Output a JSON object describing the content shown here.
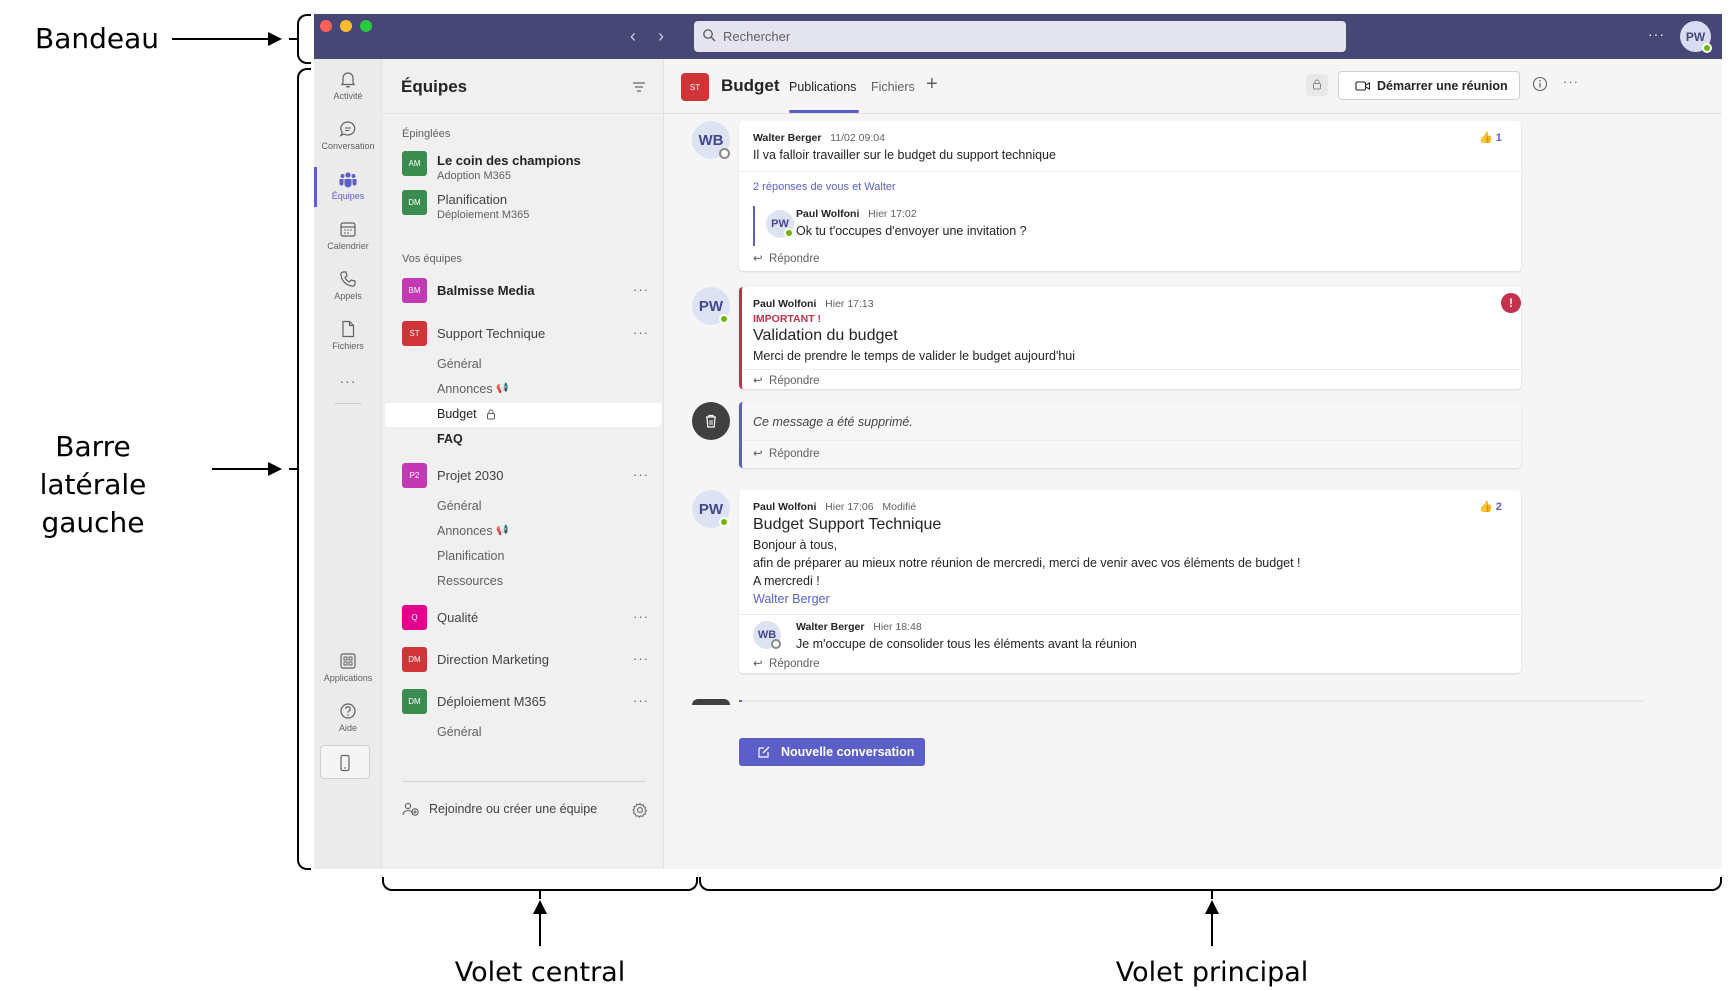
{
  "annotations": {
    "bandeau": "Bandeau",
    "sidebar_line1": "Barre latérale",
    "sidebar_line2": "gauche",
    "volet_central": "Volet central",
    "volet_principal": "Volet principal"
  },
  "titlebar": {
    "search_placeholder": "Rechercher",
    "more": "···",
    "avatar": "PW",
    "bg_color": "#464775"
  },
  "rail": {
    "items": [
      {
        "label": "Activité",
        "icon": "bell-icon"
      },
      {
        "label": "Conversation",
        "icon": "chat-icon"
      },
      {
        "label": "Équipes",
        "icon": "teams-icon"
      },
      {
        "label": "Calendrier",
        "icon": "calendar-icon"
      },
      {
        "label": "Appels",
        "icon": "phone-icon"
      },
      {
        "label": "Fichiers",
        "icon": "file-icon"
      }
    ],
    "more": "···",
    "applications": "Applications",
    "aide": "Aide",
    "accent_color": "#5b5fc7"
  },
  "teams_pane": {
    "title": "Équipes",
    "pinned_label": "Épinglées",
    "pinned": [
      {
        "abbr": "AM",
        "name": "Le coin des champions",
        "sub": "Adoption M365",
        "color": "#3b8d4f"
      },
      {
        "abbr": "DM",
        "name": "Planification",
        "sub": "Déploiement M365",
        "color": "#3b8d4f"
      }
    ],
    "your_teams_label": "Vos équipes",
    "teams": [
      {
        "abbr": "BM",
        "name": "Balmisse Media",
        "color": "#c239b3",
        "more": "···"
      },
      {
        "abbr": "ST",
        "name": "Support Technique",
        "color": "#d13438",
        "more": "···",
        "channels": [
          "Général",
          "Annonces",
          "Budget",
          "FAQ"
        ]
      },
      {
        "abbr": "P2",
        "name": "Projet 2030",
        "color": "#c239b3",
        "more": "···",
        "channels": [
          "Général",
          "Annonces",
          "Planification",
          "Ressources"
        ]
      },
      {
        "abbr": "Q",
        "name": "Qualité",
        "color": "#e3008c",
        "more": "···"
      },
      {
        "abbr": "DM",
        "name": "Direction Marketing",
        "color": "#d13438",
        "more": "···"
      },
      {
        "abbr": "DM",
        "name": "Déploiement M365",
        "color": "#3b8d4f",
        "more": "···",
        "channels": [
          "Général"
        ]
      }
    ],
    "join_label": "Rejoindre ou créer une équipe"
  },
  "channel_header": {
    "abbr": "ST",
    "name": "Budget",
    "tabs": [
      "Publications",
      "Fichiers"
    ],
    "add": "+",
    "meet_button": "Démarrer une réunion",
    "more": "···"
  },
  "posts": [
    {
      "avatar": "WB",
      "author": "Walter Berger",
      "time": "11/02 09:04",
      "text": "Il va falloir travailler sur le budget du support technique",
      "reaction": "1",
      "replies_summary": "2 réponses de vous et Walter",
      "reply": {
        "avatar": "PW",
        "author": "Paul Wolfoni",
        "time": "Hier 17:02",
        "text": "Ok tu t'occupes d'envoyer une invitation ?"
      },
      "reply_label": "Répondre"
    },
    {
      "avatar": "PW",
      "author": "Paul Wolfoni",
      "time": "Hier 17:13",
      "important": "IMPORTANT !",
      "title": "Validation du budget",
      "text": "Merci de prendre le temps de valider le budget aujourd'hui",
      "reply_label": "Répondre"
    },
    {
      "deleted_text": "Ce message a été supprimé.",
      "reply_label": "Répondre"
    },
    {
      "avatar": "PW",
      "author": "Paul Wolfoni",
      "time": "Hier 17:06",
      "edited": "Modifié",
      "title": "Budget Support Technique",
      "lines": [
        "Bonjour à tous,",
        "afin de préparer au mieux notre réunion de mercredi, merci de venir avec vos éléments de budget !",
        "A mercredi !"
      ],
      "mention": "Walter Berger",
      "reaction": "2",
      "reply": {
        "avatar": "WB",
        "author": "Walter Berger",
        "time": "Hier 18:48",
        "text": "Je m'occupe de consolider tous les éléments avant la réunion"
      },
      "reply_label": "Répondre"
    }
  ],
  "new_conversation": "Nouvelle conversation"
}
